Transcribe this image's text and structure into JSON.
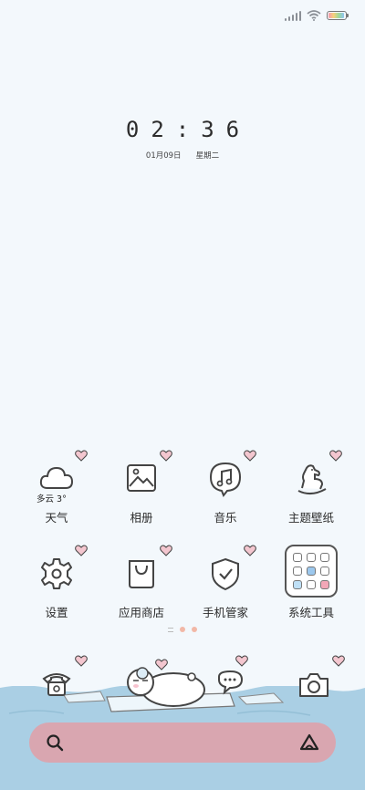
{
  "status_bar": {
    "icons": [
      "signal-icon",
      "wifi-icon",
      "battery-icon"
    ],
    "battery_colors": [
      "#f59bb0",
      "#f6d27b",
      "#9ed99b",
      "#8fc4f2"
    ]
  },
  "clock": {
    "time": "02:36",
    "date": "01月09日",
    "weekday": "星期二"
  },
  "apps": [
    {
      "label": "天气",
      "icon": "weather-cloud-icon",
      "extra": "多云 3°"
    },
    {
      "label": "相册",
      "icon": "gallery-icon"
    },
    {
      "label": "音乐",
      "icon": "music-icon"
    },
    {
      "label": "主题壁纸",
      "icon": "rocking-horse-icon"
    },
    {
      "label": "设置",
      "icon": "gear-icon"
    },
    {
      "label": "应用商店",
      "icon": "shopping-bag-icon"
    },
    {
      "label": "手机管家",
      "icon": "shield-check-icon"
    },
    {
      "label": "系统工具",
      "icon": "tools-folder-icon"
    }
  ],
  "page_indicator": {
    "pages": 3
  },
  "dock": {
    "icons": [
      "phone-icon",
      "sleeping-bear-icon",
      "message-bubble-icon",
      "camera-icon"
    ]
  },
  "search_bar": {
    "left_icon": "search-icon",
    "right_icon": "assistant-triangle-icon",
    "color": "#d9a6b0"
  },
  "colors": {
    "background": "#f3f8fc",
    "heart": "#e8a8b6",
    "sea": "#aacfe4"
  }
}
